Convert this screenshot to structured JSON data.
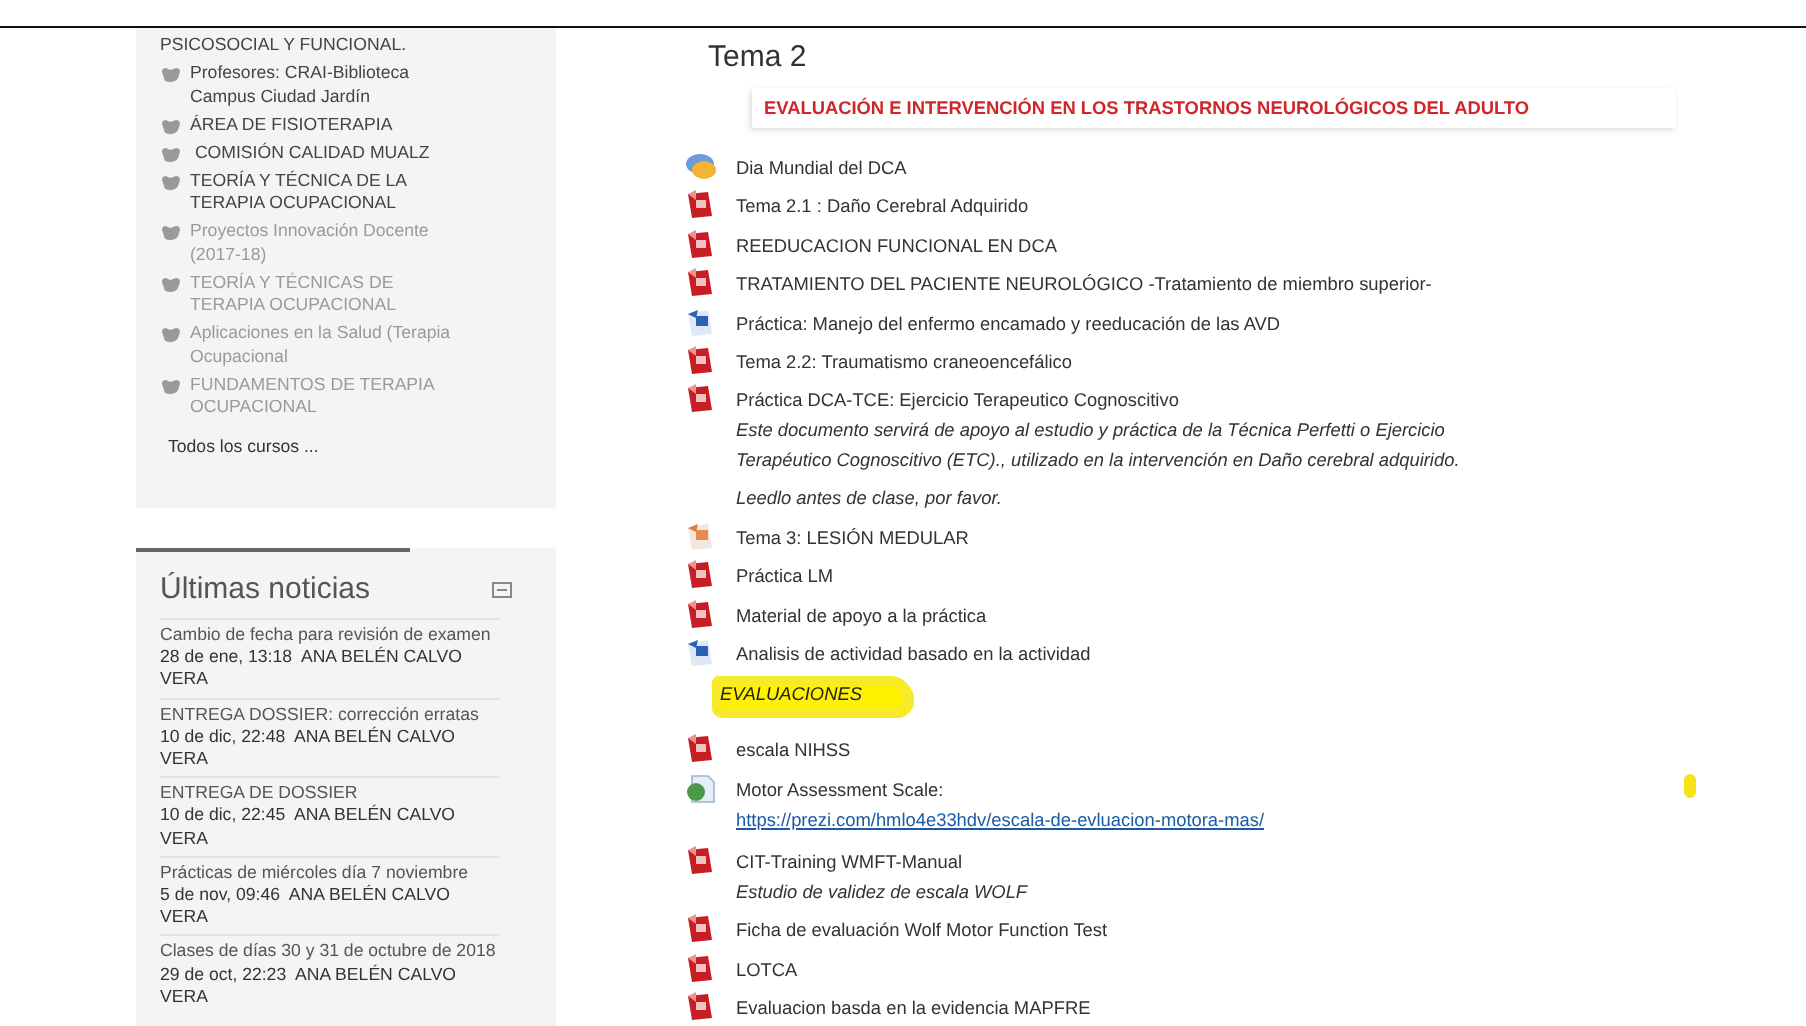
{
  "courses": {
    "items": [
      {
        "label": "PSICOSOCIAL Y FUNCIONAL.",
        "dimmed": false,
        "kind": "continuation"
      },
      {
        "label": "Profesores: CRAI-Biblioteca Campus Ciudad Jardín",
        "dimmed": false,
        "kind": "course"
      },
      {
        "label": "ÁREA DE FISIOTERAPIA",
        "dimmed": false,
        "kind": "course"
      },
      {
        "label": " COMISIÓN CALIDAD MUALZ",
        "dimmed": false,
        "kind": "course"
      },
      {
        "label": "TEORÍA Y TÉCNICA DE LA TERAPIA OCUPACIONAL",
        "dimmed": false,
        "kind": "course"
      },
      {
        "label": "Proyectos Innovación Docente (2017-18)",
        "dimmed": true,
        "kind": "course"
      },
      {
        "label": "TEORÍA Y TÉCNICAS DE TERAPIA OCUPACIONAL",
        "dimmed": true,
        "kind": "course"
      },
      {
        "label": "Aplicaciones en la Salud (Terapia Ocupacional",
        "dimmed": true,
        "kind": "course"
      },
      {
        "label": "FUNDAMENTOS DE TERAPIA OCUPACIONAL",
        "dimmed": true,
        "kind": "course"
      }
    ],
    "all_link": "Todos los cursos ..."
  },
  "news": {
    "title": "Últimas noticias",
    "items": [
      {
        "subject": "Cambio de fecha para revisión de examen",
        "date": "28 de ene, 13:18",
        "author": "ANA BELÉN CALVO VERA"
      },
      {
        "subject": "ENTREGA DOSSIER: corrección erratas",
        "date": "10 de dic, 22:48",
        "author": "ANA BELÉN CALVO VERA"
      },
      {
        "subject": "ENTREGA DE DOSSIER",
        "date": "10 de dic, 22:45",
        "author": "ANA BELÉN CALVO VERA"
      },
      {
        "subject": "Prácticas de miércoles día 7 noviembre",
        "date": "5 de nov, 09:46",
        "author": "ANA BELÉN CALVO VERA"
      },
      {
        "subject": "Clases de días 30 y 31 de octubre de 2018",
        "date": "29 de oct, 22:23",
        "author": "ANA BELÉN CALVO VERA"
      }
    ]
  },
  "section": {
    "title": "Tema 2",
    "banner": "EVALUACIÓN E INTERVENCIÓN EN LOS TRASTORNOS NEUROLÓGICOS DEL ADULTO",
    "items": [
      {
        "kind": "forum",
        "label": "Dia Mundial del DCA"
      },
      {
        "kind": "pdf",
        "label": "Tema 2.1 : Daño Cerebral Adquirido"
      },
      {
        "kind": "pdf",
        "label": "REEDUCACION FUNCIONAL EN DCA"
      },
      {
        "kind": "pdf",
        "label": "TRATAMIENTO DEL PACIENTE NEUROLÓGICO -Tratamiento de miembro superior-"
      },
      {
        "kind": "word",
        "label": "Práctica: Manejo del enfermo encamado y reeducación de las AVD"
      },
      {
        "kind": "pdf",
        "label": "Tema 2.2: Traumatismo craneoencefálico"
      },
      {
        "kind": "pdf",
        "label": "Práctica DCA-TCE: Ejercicio Terapeutico Cognoscitivo",
        "description": [
          "Este documento servirá de apoyo al estudio y práctica de la Técnica Perfetti o Ejercicio Terapéutico Cognoscitivo (ETC)., utilizado en la intervención en Daño cerebral adquirido.",
          "Leedlo antes de clase, por favor."
        ]
      },
      {
        "kind": "ppt",
        "label": "Tema 3: LESIÓN MEDULAR"
      },
      {
        "kind": "pdf",
        "label": "Práctica LM"
      },
      {
        "kind": "pdf",
        "label": "Material de apoyo a la práctica"
      },
      {
        "kind": "word",
        "label": "Analisis de actividad basado en la actividad"
      },
      {
        "kind": "label",
        "label": "EVALUACIONES",
        "highlighted": true
      },
      {
        "kind": "pdf",
        "label": "escala NIHSS"
      },
      {
        "kind": "url",
        "label": "Motor Assessment Scale:",
        "link": "https://prezi.com/hmlo4e33hdv/escala-de-evluacion-motora-mas/"
      },
      {
        "kind": "pdf",
        "label": "CIT-Training WMFT-Manual",
        "description": [
          "Estudio de validez de escala WOLF"
        ]
      },
      {
        "kind": "pdf",
        "label": "Ficha de evaluación Wolf Motor Function Test"
      },
      {
        "kind": "pdf",
        "label": "LOTCA"
      },
      {
        "kind": "pdf",
        "label": "Evaluacion basda en la evidencia MAPFRE"
      }
    ]
  }
}
